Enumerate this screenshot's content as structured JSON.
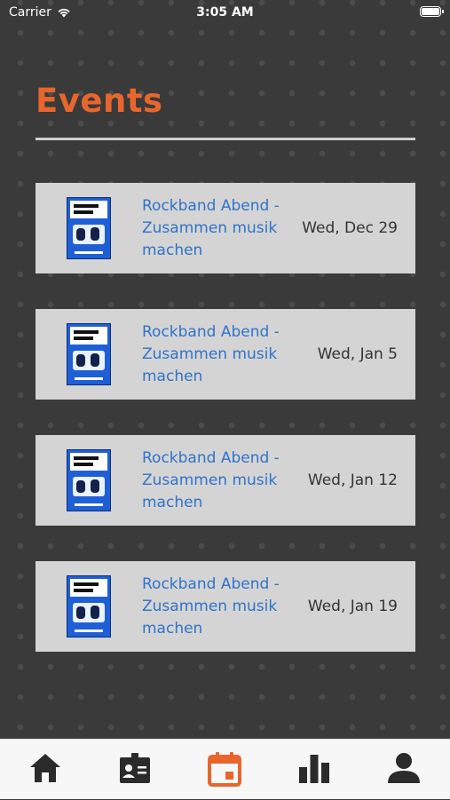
{
  "status_bar": {
    "carrier": "Carrier",
    "time": "3:05 AM"
  },
  "header": {
    "title": "Events"
  },
  "events": [
    {
      "title": "Rockband Abend - Zusammen musik machen",
      "date": "Wed, Dec 29",
      "thumbnail_icon": "rockband-poster-image"
    },
    {
      "title": "Rockband Abend - Zusammen musik machen",
      "date": "Wed, Jan 5",
      "thumbnail_icon": "rockband-poster-image"
    },
    {
      "title": "Rockband Abend - Zusammen musik machen",
      "date": "Wed, Jan 12",
      "thumbnail_icon": "rockband-poster-image"
    },
    {
      "title": "Rockband Abend - Zusammen musik machen",
      "date": "Wed, Jan 19",
      "thumbnail_icon": "rockband-poster-image"
    }
  ],
  "tab_bar": {
    "active": "events",
    "items": [
      {
        "key": "home",
        "icon": "home-icon"
      },
      {
        "key": "membership",
        "icon": "id-badge-icon"
      },
      {
        "key": "events",
        "icon": "calendar-icon"
      },
      {
        "key": "stats",
        "icon": "bar-chart-icon"
      },
      {
        "key": "profile",
        "icon": "user-icon"
      }
    ]
  },
  "colors": {
    "accent": "#e8662c",
    "tab_inactive": "#2b2b2b",
    "event_title": "#2f73c9",
    "card_background": "#d4d4d4",
    "page_background": "#3a3a3a"
  }
}
